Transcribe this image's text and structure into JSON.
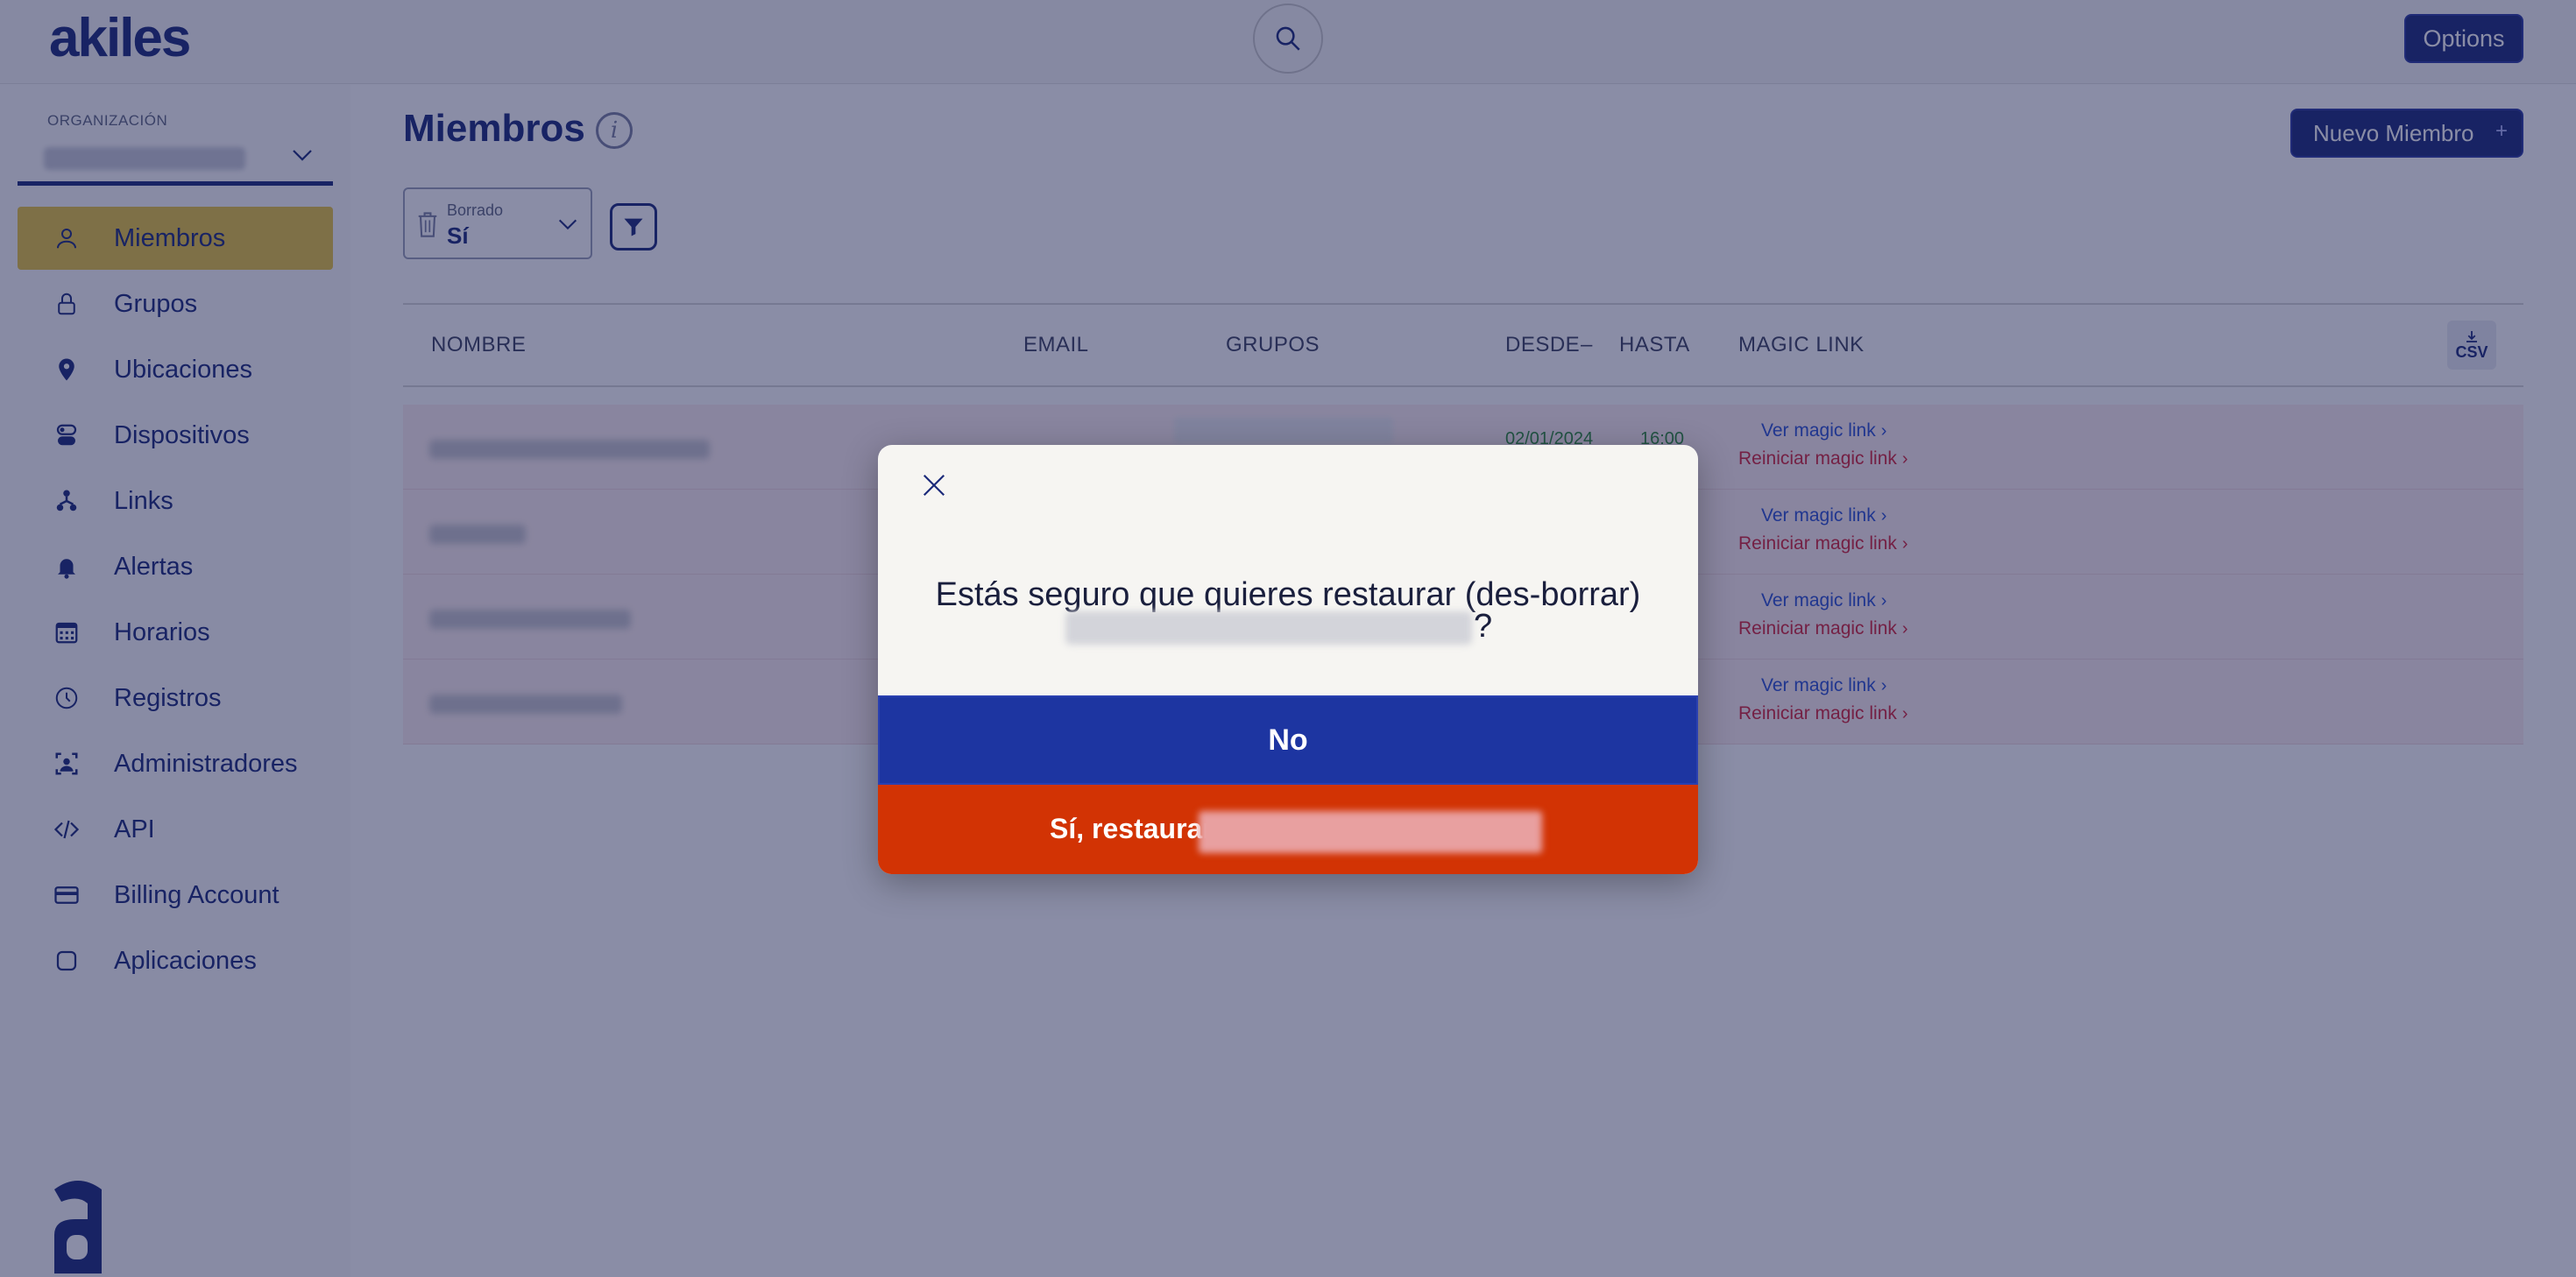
{
  "header": {
    "logo": "akiles",
    "options_label": "Options"
  },
  "sidebar": {
    "org_label": "ORGANIZACIÓN",
    "items": [
      {
        "label": "Miembros",
        "icon": "user-icon",
        "active": true
      },
      {
        "label": "Grupos",
        "icon": "lock-icon"
      },
      {
        "label": "Ubicaciones",
        "icon": "location-pin-icon"
      },
      {
        "label": "Dispositivos",
        "icon": "device-icon"
      },
      {
        "label": "Links",
        "icon": "network-icon"
      },
      {
        "label": "Alertas",
        "icon": "bell-icon"
      },
      {
        "label": "Horarios",
        "icon": "calendar-icon"
      },
      {
        "label": "Registros",
        "icon": "clock-icon"
      },
      {
        "label": "Administradores",
        "icon": "admin-icon"
      },
      {
        "label": "API",
        "icon": "code-icon"
      },
      {
        "label": "Billing Account",
        "icon": "credit-card-icon"
      },
      {
        "label": "Aplicaciones",
        "icon": "square-icon"
      }
    ]
  },
  "main": {
    "title": "Miembros",
    "new_member_label": "Nuevo Miembro",
    "new_member_plus": "+",
    "filter": {
      "label": "Borrado",
      "value": "Sí"
    },
    "table": {
      "headers": {
        "name": "NOMBRE",
        "email": "EMAIL",
        "groups": "GRUPOS",
        "from": "DESDE",
        "sort": "–",
        "to": "HASTA",
        "magic_link": "MAGIC LINK"
      },
      "csv_label": "CSV",
      "rows": [
        {
          "from": "02/01/2024",
          "to": "16:00",
          "view": "Ver magic link",
          "reset": "Reiniciar magic link"
        },
        {
          "from": "",
          "to": "",
          "view": "Ver magic link",
          "reset": "Reiniciar magic link"
        },
        {
          "from": "",
          "to": "",
          "view": "Ver magic link",
          "reset": "Reiniciar magic link"
        },
        {
          "from": "",
          "to": "",
          "view": "Ver magic link",
          "reset": "Reiniciar magic link"
        }
      ]
    }
  },
  "modal": {
    "message": "Estás seguro que quieres restaurar (des-borrar)",
    "question_mark": "?",
    "no_label": "No",
    "yes_label": "Sí, restaurar"
  },
  "colors": {
    "brand": "#1b2a7a",
    "active_nav": "#e6c441",
    "no_button": "#1d35a1",
    "yes_button": "#d23304"
  }
}
